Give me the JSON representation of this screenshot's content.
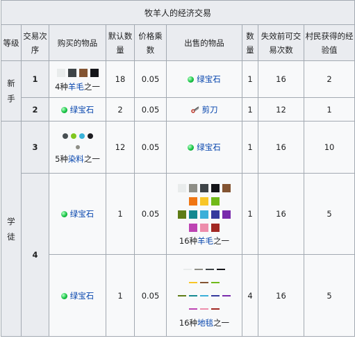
{
  "title": "牧羊人的经济交易",
  "headers": {
    "level": "等级",
    "index": "交易次序",
    "buy": "购买的物品",
    "default_qty": "默认数量",
    "multiplier": "价格乘数",
    "sell": "出售的物品",
    "qty": "数量",
    "max_uses": "失效前可交易次数",
    "xp": "村民获得的经验值"
  },
  "levels": {
    "novice": "新手",
    "apprentice": "学徒"
  },
  "rows": [
    {
      "index": "1",
      "buy_prefix": "4种",
      "buy_link": "羊毛",
      "buy_suffix": "之一",
      "default_qty": "18",
      "multiplier": "0.05",
      "sell": "绿宝石",
      "qty": "1",
      "max_uses": "16",
      "xp": "2"
    },
    {
      "index": "2",
      "buy": "绿宝石",
      "default_qty": "2",
      "multiplier": "0.05",
      "sell": "剪刀",
      "qty": "1",
      "max_uses": "12",
      "xp": "1"
    },
    {
      "index": "3",
      "buy_prefix": "5种",
      "buy_link": "染料",
      "buy_suffix": "之一",
      "default_qty": "12",
      "multiplier": "0.05",
      "sell": "绿宝石",
      "qty": "1",
      "max_uses": "16",
      "xp": "10"
    },
    {
      "index": "4",
      "buy": "绿宝石",
      "default_qty": "1",
      "multiplier": "0.05",
      "sell_prefix": "16种",
      "sell_link": "羊毛",
      "sell_suffix": "之一",
      "qty": "1",
      "max_uses": "16",
      "xp": "5"
    },
    {
      "buy": "绿宝石",
      "default_qty": "1",
      "multiplier": "0.05",
      "sell_prefix": "16种",
      "sell_link": "地毯",
      "sell_suffix": "之一",
      "qty": "4",
      "max_uses": "16",
      "xp": "5"
    }
  ],
  "icons": {
    "emerald": "emerald-icon",
    "shears": "shears-icon",
    "wool": "wool-block-icon",
    "dye": "dye-icon",
    "carpet": "carpet-icon"
  },
  "colors": {
    "header_bg": "#eaecf0",
    "cell_bg": "#f8f9fa",
    "border": "#a2a9b1",
    "link": "#0645ad",
    "emerald": "#17c544",
    "wool_row1": [
      "#e9ecec",
      "#3e4447",
      "#835432",
      "#141519"
    ],
    "dyes": [
      "#474f52",
      "#80c71f",
      "#3ab3da",
      "#1d1d21"
    ],
    "wool_16": [
      "#e9ecec",
      "#8e8e86",
      "#3e4447",
      "#141519",
      "#835432",
      "#f07613",
      "#f8c627",
      "#70b919",
      "#5e7c16",
      "#158991",
      "#3aafd9",
      "#35399d",
      "#792aac",
      "#bd44b3",
      "#ed8dac",
      "#a12722"
    ],
    "carpets": [
      "#e9ecec",
      "#8e8e86",
      "#3e4447",
      "#141519",
      "#f8c627",
      "#835432",
      "#f07613",
      "#70b919",
      "#5e7c16",
      "#158991",
      "#3aafd9",
      "#35399d",
      "#792aac",
      "#bd44b3",
      "#ed8dac",
      "#a12722"
    ]
  }
}
